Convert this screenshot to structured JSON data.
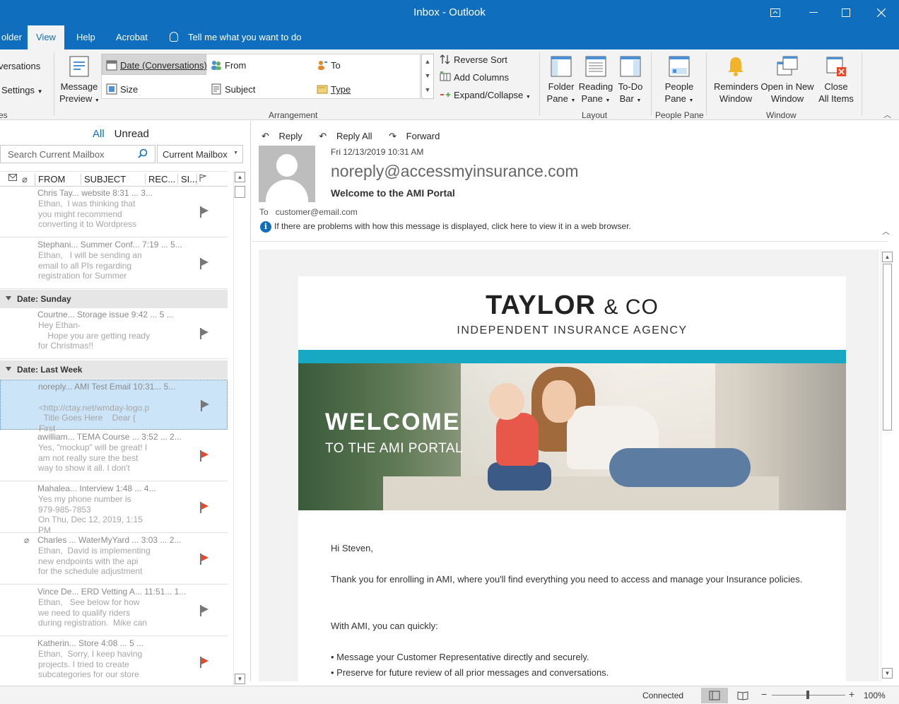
{
  "window": {
    "title": "Inbox - Outlook"
  },
  "menu": {
    "tabs": [
      "older",
      "View",
      "Help",
      "Acrobat"
    ],
    "active": "View",
    "tellme": "Tell me what you want to do"
  },
  "ribbon": {
    "conversations_label": "versations",
    "conv_settings_label": "Settings",
    "left_cut_label": "es",
    "message_preview": [
      "Message",
      "Preview"
    ],
    "arrangement": {
      "date": "Date (Conversations)",
      "from": "From",
      "to": "To",
      "size": "Size",
      "subject": "Subject",
      "type": "Type",
      "reverse_sort": "Reverse Sort",
      "add_columns": "Add Columns",
      "expand_collapse": "Expand/Collapse",
      "group_label": "Arrangement"
    },
    "layout": {
      "folder_pane": [
        "Folder",
        "Pane"
      ],
      "reading_pane": [
        "Reading",
        "Pane"
      ],
      "todo_bar": [
        "To-Do",
        "Bar"
      ],
      "group_label": "Layout"
    },
    "people": {
      "people_pane": [
        "People",
        "Pane"
      ],
      "group_label": "People Pane"
    },
    "window": {
      "reminders": [
        "Reminders",
        "Window"
      ],
      "open_new": [
        "Open in New",
        "Window"
      ],
      "close_all": [
        "Close",
        "All Items"
      ],
      "group_label": "Window"
    }
  },
  "mail_list": {
    "filters": {
      "all": "All",
      "unread": "Unread"
    },
    "search_placeholder": "Search Current Mailbox",
    "scope": "Current Mailbox",
    "columns": {
      "from": "FROM",
      "subject": "SUBJECT",
      "received": "REC...",
      "size": "SI..."
    },
    "group_sunday": "Date: Sunday",
    "group_last_week": "Date: Last Week",
    "messages": [
      {
        "line1": "Chris Tay...  website          8:31 ...  3...",
        "preview": "Ethan,  I was thinking that\nyou might recommend\nconverting it to Wordpress"
      },
      {
        "line1": "Stephani...  Summer Conf...  7:19 ...  5...",
        "preview": "Ethan,   I will be sending an\nemail to all PIs regarding\nregistration for Summer"
      },
      {
        "line1": "Courtne...    Storage issue      9:42 ...  5 ...",
        "preview": "Hey Ethan-\n    Hope you are getting ready\nfor Christmas!!"
      },
      {
        "line1": "noreply...    AMI Test Email    10:31...  5...",
        "preview": "\n<http://ctay.net/wmday-logo.p\n  Title Goes Here    Dear { First"
      },
      {
        "line1": "awilliam...  TEMA Course ...  3:52 ...  2...",
        "preview": "Yes, \"mockup\" will be great! I\nam not really sure the best\nway to show it all. I don't"
      },
      {
        "line1": "Mahalea...   Interview           1:48 ...  4...",
        "preview": "Yes my phone number is\n979-985-7853\nOn Thu, Dec 12, 2019, 1:15 PM"
      },
      {
        "line1": "Charles ...  WaterMyYard ...  3:03 ...  2...",
        "preview": "Ethan,  David is implementing\nnew endpoints with the api\nfor the schedule adjustment"
      },
      {
        "line1": "Vince De...  ERD Vetting A...  11:51...  1...",
        "preview": "Ethan,   See below for how\nwe need to qualify riders\nduring registration.  Mike can"
      },
      {
        "line1": "Katherin...   Store                 4:08 ...  5 ...",
        "preview": "Ethan,  Sorry, I keep having\nprojects. I tried to create\nsubcategories for our store"
      }
    ]
  },
  "reading_pane": {
    "actions": {
      "reply": "Reply",
      "reply_all": "Reply All",
      "forward": "Forward"
    },
    "date": "Fri 12/13/2019 10:31 AM",
    "from": "noreply@accessmyinsurance.com",
    "subject": "Welcome to the AMI Portal",
    "to_label": "To",
    "to_addr": "customer@email.com",
    "info": "If there are problems with how this message is displayed, click here to view it in a web browser.",
    "body": {
      "brand": "TAYLOR",
      "brand_amp": "& CO",
      "tagline": "INDEPENDENT INSURANCE AGENCY",
      "welcome": "WELCOME",
      "welcome_sub": "TO THE AMI PORTAL",
      "greeting": "Hi Steven,",
      "para1": "Thank you for enrolling in AMI, where you'll find everything you need to access and manage your Insurance policies.",
      "para2": "With AMI, you can quickly:",
      "bullet1": "• Message your Customer Representative directly and securely.",
      "bullet2": "• Preserve for future review of all prior messages and conversations."
    }
  },
  "status": {
    "connected": "Connected",
    "zoom": "100%"
  },
  "colors": {
    "brand_blue": "#106ebe",
    "teal": "#17a8c4",
    "flag_red": "#e8492b"
  }
}
